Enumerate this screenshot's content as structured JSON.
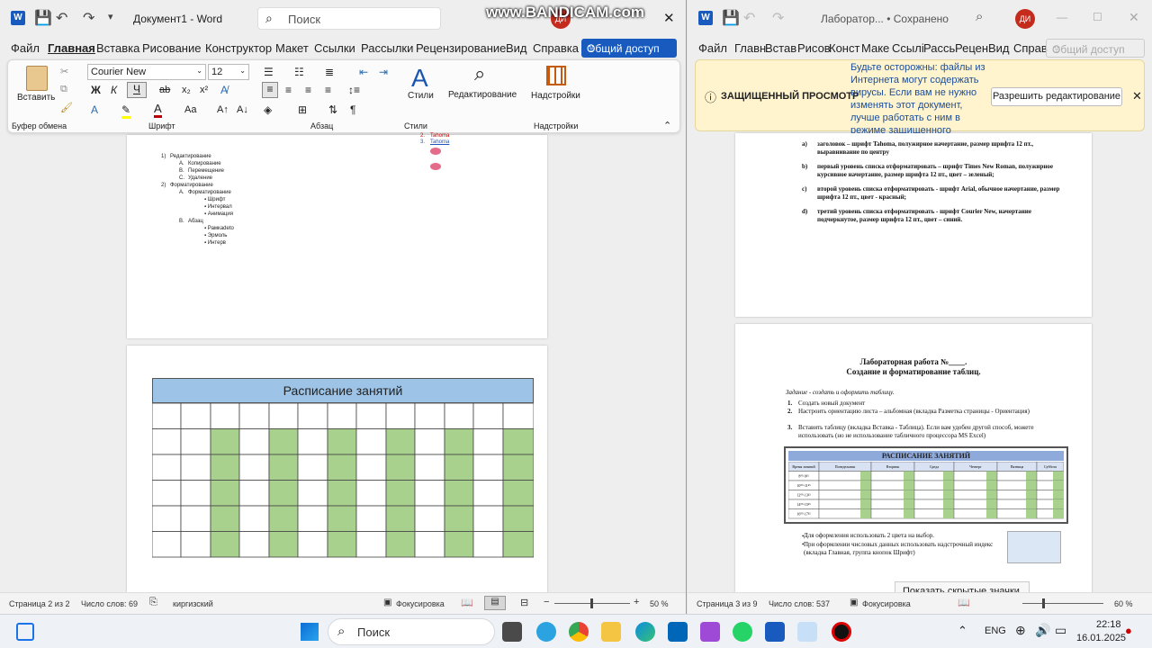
{
  "left": {
    "title": "Документ1 - Word",
    "search_placeholder": "Поиск",
    "user_initials": "ДИ",
    "menu": [
      "Файл",
      "Главная",
      "Вставка",
      "Рисование",
      "Конструктор",
      "Макет",
      "Ссылки",
      "Рассылки",
      "Рецензирование",
      "Вид",
      "Справка"
    ],
    "share_label": "Общий доступ",
    "ribbon": {
      "paste_label": "Вставить",
      "font_name": "Courier New",
      "font_size": "12",
      "styles_label": "Стили",
      "editing_label": "Редактирование",
      "addins_label": "Надстройки",
      "groups": [
        "Буфер обмена",
        "Шрифт",
        "Абзац",
        "Стили",
        "Надстройки"
      ],
      "font_buttons": [
        "Ж",
        "К",
        "Ч",
        "ab",
        "x₂",
        "x²",
        "A",
        "Aa",
        "A↑",
        "A↓"
      ]
    },
    "doc_list": [
      "1)",
      "Редактирование",
      "A.",
      "Копирование",
      "B.",
      "Перемещение",
      "C.",
      "Удаление",
      "2)",
      "Форматирование",
      "A.",
      "Форматирование",
      "Шрифт",
      "Интервал",
      "Анимация",
      "B.",
      "Абзац",
      "Рамкаdeto",
      "Эрмоль",
      "Интерв"
    ],
    "doc_list2": [
      "2.",
      "Tahoma",
      "3.",
      "Tahoma"
    ],
    "table_title": "Расписание занятий",
    "status": {
      "page": "Страница 2 из 2",
      "words": "Число слов: 69",
      "lang": "киргизский",
      "focus": "Фокусировка",
      "zoom": "50 %"
    }
  },
  "right": {
    "title": "Лаборатор... • Сохранено",
    "user_initials": "ДИ",
    "menu": [
      "Файл",
      "Главн",
      "Встав",
      "Рисов",
      "Конст",
      "Маке",
      "Ссылі",
      "Рассь",
      "Рецен",
      "Вид",
      "Справ"
    ],
    "share_label": "Общий доступ",
    "protected": {
      "title": "ЗАЩИЩЕННЫЙ ПРОСМОТР",
      "message": "Будьте осторожны: файлы из Интернета могут содержать вирусы. Если вам не нужно изменять этот документ, лучше работать с ним в режиме защищенного просмотра.",
      "enable_button": "Разрешить редактирование"
    },
    "page1_items": [
      {
        "m": "a)",
        "t": "заголовок – шрифт Tahoma, полужирное начертание, размер шрифта 12 пт., выравнивание по центру"
      },
      {
        "m": "b)",
        "t": "первый уровень списка отформатировать – шрифт Times New Roman, полужирное курсивное начертание, размер шрифта 12 пт., цвет – зеленый;"
      },
      {
        "m": "c)",
        "t": "второй уровень списка отформатировать - шрифт Arial, обычное начертание, размер шрифта 12 пт., цвет - красный;"
      },
      {
        "m": "d)",
        "t": "третий уровень списка отформатировать - шрифт Courier New, начертание подчеркнутое, размер шрифта 12 пт., цвет – синий."
      }
    ],
    "page2": {
      "heading1": "Лабораторная работа №____.",
      "heading2": "Создание и форматирование таблиц.",
      "task": "Задание - создать и оформить таблицу.",
      "steps": [
        "Создать новый документ",
        "Настроить ориентацию листа – альбомная (вкладка Разметка страницы - Ориентация)",
        "Вставить таблицу (вкладка Вставка - Таблица). Если вам удобен другой способ, можете использовать (но не использование табличного процессора MS Excel)"
      ],
      "sched_title": "РАСПИСАНИЕ ЗАНЯТИЙ",
      "sched_cols": [
        "Время занятий",
        "Понедельник",
        "Вторник",
        "Среда",
        "Четверг",
        "Пятница",
        "Суббота"
      ],
      "sched_times": [
        "8⁰⁰-9⁴⁵",
        "10⁰⁰-11⁴⁵",
        "12⁰⁰-13⁴⁵",
        "14⁰⁰-15⁴⁵",
        "16⁰⁰-17⁴⁵"
      ],
      "bullets": [
        "Для оформления использовать 2 цвета на выбор.",
        "При оформлении числовых данных использовать надстрочный индекс (вкладка Главная, группа кнопок Шрифт)"
      ]
    },
    "tooltip": "Показать скрытые значки",
    "status": {
      "page": "Страница 3 из 9",
      "words": "Число слов: 537",
      "focus": "Фокусировка",
      "zoom": "60 %"
    }
  },
  "watermark": "www.BANDICAM.com",
  "taskbar": {
    "search_placeholder": "Поиск",
    "lang": "ENG",
    "time": "22:18",
    "date": "16.01.2025"
  },
  "colors": {
    "word_blue": "#185abd",
    "table_green": "#a9d18e",
    "table_header": "#9dc3e6",
    "warning_yellow": "#fff4ce"
  }
}
